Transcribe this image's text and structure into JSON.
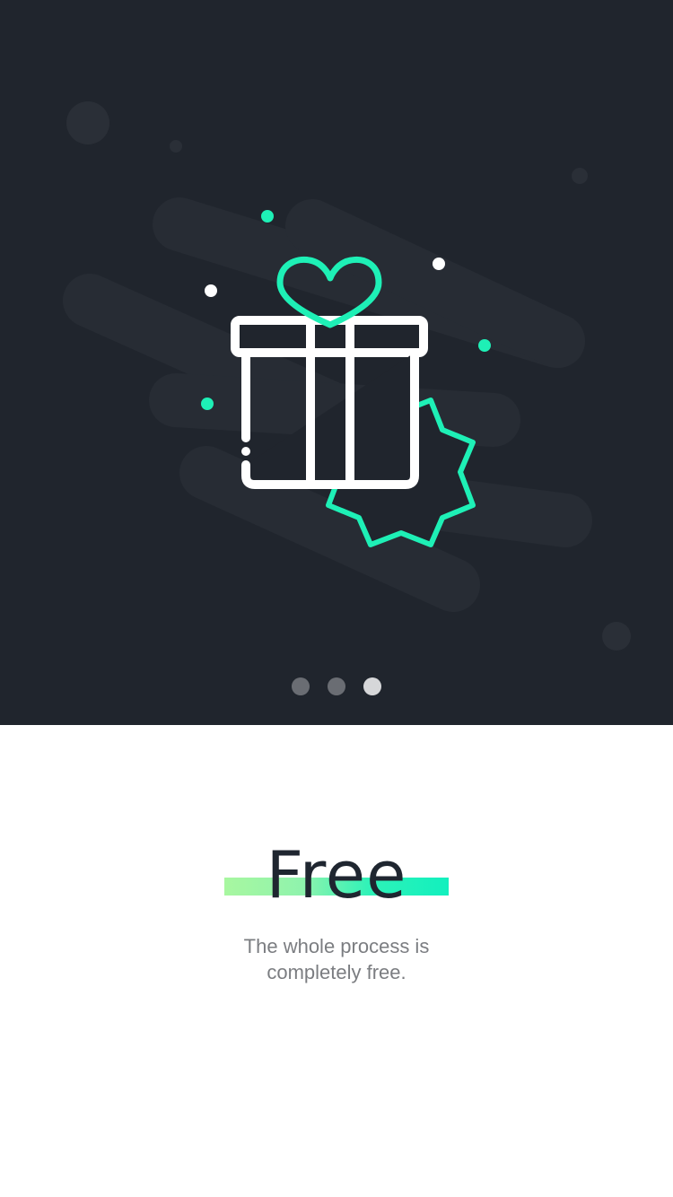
{
  "onboarding": {
    "title": "Free",
    "subtitle_line1": "The whole process is",
    "subtitle_line2": "completely free.",
    "pager": {
      "total": 3,
      "active_index": 3
    },
    "illustration": {
      "icon": "gift-box-icon",
      "badge_icon": "badge-icon"
    }
  },
  "colors": {
    "hero_background": "#20252d",
    "accent": "#1ef0b6",
    "title": "#1f2630",
    "subtitle": "#7b7d81",
    "highlight_start": "#a8f7a0",
    "highlight_end": "#12f0be"
  }
}
